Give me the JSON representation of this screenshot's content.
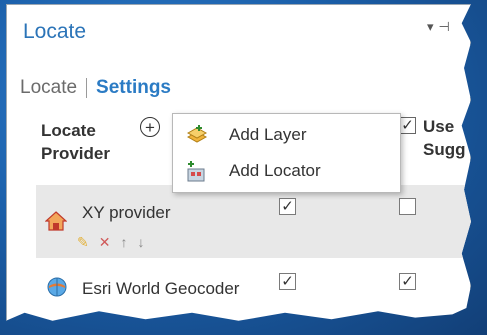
{
  "window": {
    "title": "Locate"
  },
  "tabs": [
    {
      "label": "Locate",
      "active": false
    },
    {
      "label": "Settings",
      "active": true
    }
  ],
  "table": {
    "columns": {
      "provider_line1": "Locate",
      "provider_line2": "Provider",
      "use_line1": "Use",
      "use_line2": "Sugg"
    }
  },
  "add_menu": {
    "items": [
      {
        "label": "Add Layer",
        "icon": "add-layer-icon"
      },
      {
        "label": "Add Locator",
        "icon": "add-locator-icon"
      }
    ]
  },
  "providers": [
    {
      "name": "XY provider",
      "icon": "house-icon",
      "enabled": true,
      "use_suggestions": false,
      "selected": true
    },
    {
      "name": "Esri World Geocoder",
      "icon": "globe-icon",
      "enabled": true,
      "use_suggestions": true,
      "selected": false
    }
  ],
  "colors": {
    "accent": "#2b74b8",
    "desktop": "#1b5fa9",
    "row_selected": "#e8e8e8"
  }
}
